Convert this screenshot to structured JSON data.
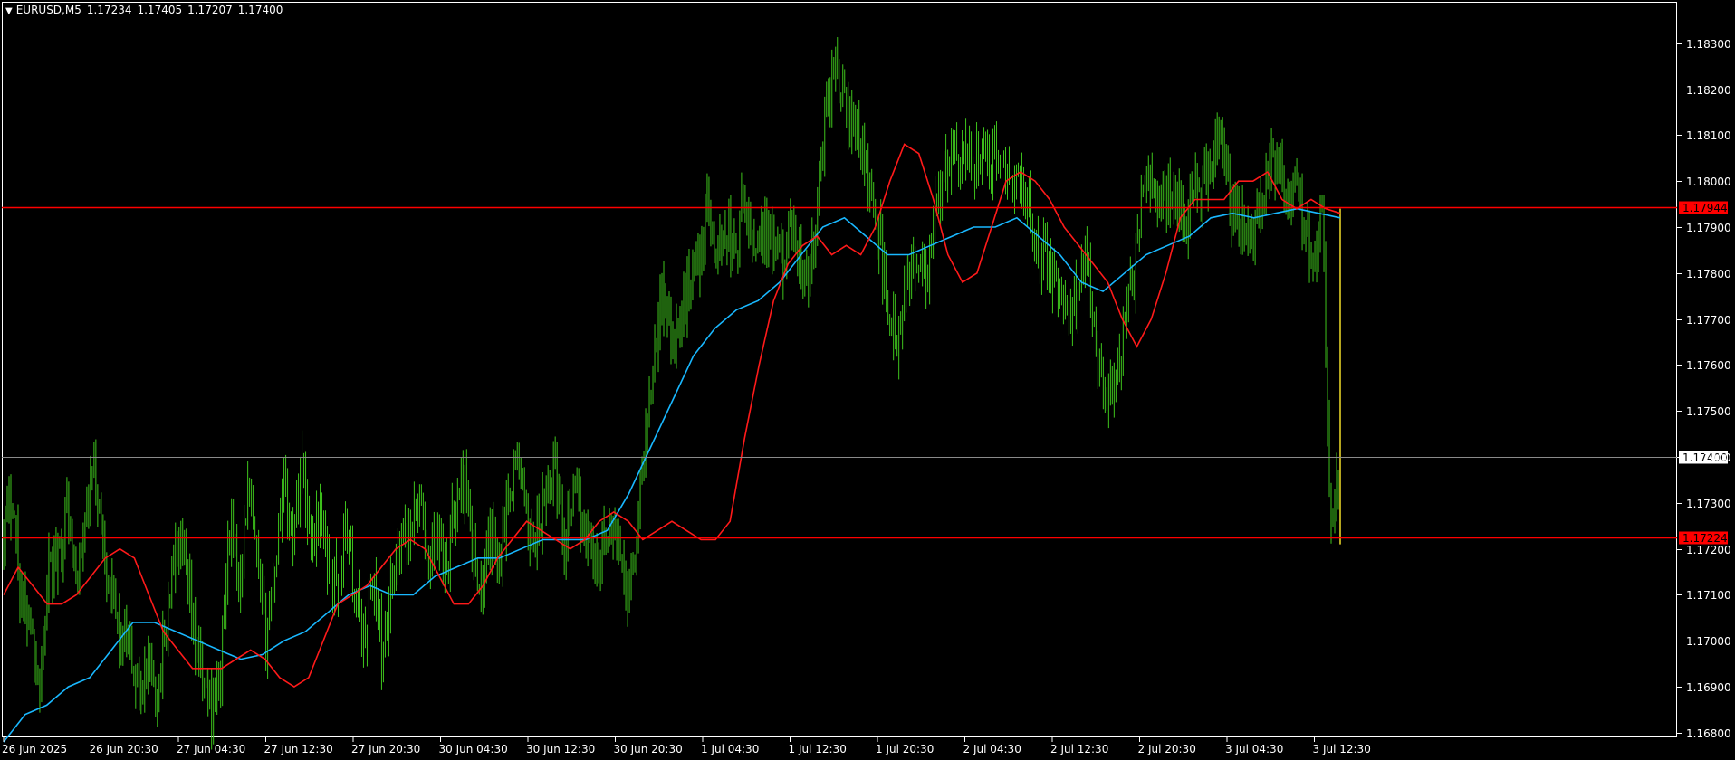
{
  "chart_data": {
    "type": "candlestick",
    "symbol": "EURUSD,M5",
    "ohlc_header": {
      "open": "1.17234",
      "high": "1.17405",
      "low": "1.17207",
      "close": "1.17400"
    },
    "header_arrow": "▼",
    "ylim": [
      1.1679,
      1.1839
    ],
    "y_ticks": [
      "1.18300",
      "1.18200",
      "1.18100",
      "1.18000",
      "1.17900",
      "1.17800",
      "1.17700",
      "1.17600",
      "1.17500",
      "1.17400",
      "1.17300",
      "1.17200",
      "1.17100",
      "1.17000",
      "1.16900",
      "1.16800"
    ],
    "x_tick_labels": [
      "26 Jun 2025",
      "26 Jun 20:30",
      "27 Jun 04:30",
      "27 Jun 12:30",
      "27 Jun 20:30",
      "30 Jun 04:30",
      "30 Jun 12:30",
      "30 Jun 20:30",
      "1 Jul 04:30",
      "1 Jul 12:30",
      "1 Jul 20:30",
      "2 Jul 04:30",
      "2 Jul 12:30",
      "2 Jul 20:30",
      "3 Jul 04:30",
      "3 Jul 12:30"
    ],
    "price_path": [
      1.1725,
      1.1732,
      1.1708,
      1.1704,
      1.169,
      1.1714,
      1.1718,
      1.173,
      1.1712,
      1.1724,
      1.1738,
      1.1722,
      1.171,
      1.17,
      1.1696,
      1.169,
      1.1694,
      1.1688,
      1.1704,
      1.172,
      1.1716,
      1.1702,
      1.1692,
      1.1686,
      1.1692,
      1.1726,
      1.1712,
      1.1732,
      1.1718,
      1.17,
      1.1716,
      1.1736,
      1.1722,
      1.174,
      1.1722,
      1.1728,
      1.1716,
      1.1712,
      1.1726,
      1.1708,
      1.17,
      1.1714,
      1.1694,
      1.1712,
      1.172,
      1.1724,
      1.1732,
      1.1716,
      1.1724,
      1.1718,
      1.1728,
      1.1736,
      1.1718,
      1.1712,
      1.1722,
      1.172,
      1.1734,
      1.174,
      1.1724,
      1.1722,
      1.173,
      1.174,
      1.1722,
      1.1732,
      1.1726,
      1.1722,
      1.1716,
      1.1726,
      1.1722,
      1.171,
      1.1722,
      1.1742,
      1.1764,
      1.1776,
      1.1766,
      1.177,
      1.178,
      1.1784,
      1.1794,
      1.1784,
      1.179,
      1.1784,
      1.1796,
      1.1786,
      1.179,
      1.1786,
      1.1782,
      1.1788,
      1.1784,
      1.1776,
      1.179,
      1.1816,
      1.1826,
      1.1818,
      1.1812,
      1.1808,
      1.1796,
      1.1786,
      1.1772,
      1.1762,
      1.1778,
      1.1784,
      1.1776,
      1.179,
      1.18,
      1.1806,
      1.1808,
      1.1803,
      1.1806,
      1.1802,
      1.1808,
      1.1798,
      1.18,
      1.1798,
      1.179,
      1.1784,
      1.178,
      1.1774,
      1.177,
      1.1778,
      1.1788,
      1.1762,
      1.1754,
      1.1758,
      1.1766,
      1.1778,
      1.1796,
      1.18,
      1.1796,
      1.1798,
      1.1796,
      1.1792,
      1.1798,
      1.18,
      1.1806,
      1.1808,
      1.1792,
      1.179,
      1.1788,
      1.1796,
      1.18,
      1.1806,
      1.1796,
      1.1798,
      1.1791,
      1.1784,
      1.1794,
      1.1722,
      1.174
    ],
    "ma_fast": [
      1.171,
      1.1716,
      1.1712,
      1.1708,
      1.1708,
      1.171,
      1.1714,
      1.1718,
      1.172,
      1.1718,
      1.171,
      1.1702,
      1.1698,
      1.1694,
      1.1694,
      1.1694,
      1.1696,
      1.1698,
      1.1696,
      1.1692,
      1.169,
      1.1692,
      1.17,
      1.1708,
      1.171,
      1.1712,
      1.1716,
      1.172,
      1.1722,
      1.172,
      1.1714,
      1.1708,
      1.1708,
      1.1712,
      1.1718,
      1.1722,
      1.1726,
      1.1724,
      1.1722,
      1.172,
      1.1722,
      1.1726,
      1.1728,
      1.1726,
      1.1722,
      1.1724,
      1.1726,
      1.1724,
      1.1722,
      1.1722,
      1.1726,
      1.1744,
      1.176,
      1.1774,
      1.1782,
      1.1786,
      1.1788,
      1.1784,
      1.1786,
      1.1784,
      1.179,
      1.18,
      1.1808,
      1.1806,
      1.1796,
      1.1784,
      1.1778,
      1.178,
      1.179,
      1.18,
      1.1802,
      1.18,
      1.1796,
      1.179,
      1.1786,
      1.1782,
      1.1778,
      1.177,
      1.1764,
      1.177,
      1.178,
      1.1792,
      1.1796,
      1.1796,
      1.1796,
      1.18,
      1.18,
      1.1802,
      1.1796,
      1.1794,
      1.1796,
      1.1794,
      1.1793
    ],
    "ma_slow": [
      1.1678,
      1.1684,
      1.1686,
      1.169,
      1.1692,
      1.1698,
      1.1704,
      1.1704,
      1.1702,
      1.17,
      1.1698,
      1.1696,
      1.1697,
      1.17,
      1.1702,
      1.1706,
      1.171,
      1.1712,
      1.171,
      1.171,
      1.1714,
      1.1716,
      1.1718,
      1.1718,
      1.172,
      1.1722,
      1.1722,
      1.1722,
      1.1724,
      1.1732,
      1.1742,
      1.1752,
      1.1762,
      1.1768,
      1.1772,
      1.1774,
      1.1778,
      1.1784,
      1.179,
      1.1792,
      1.1788,
      1.1784,
      1.1784,
      1.1786,
      1.1788,
      1.179,
      1.179,
      1.1792,
      1.1788,
      1.1784,
      1.1778,
      1.1776,
      1.178,
      1.1784,
      1.1786,
      1.1788,
      1.1792,
      1.1793,
      1.1792,
      1.1793,
      1.1794,
      1.1793,
      1.1792
    ],
    "horizontal_lines": [
      {
        "price": 1.17944,
        "label": "1.17944",
        "color": "#ff0000",
        "label_bg": "#ff0000",
        "label_color": "#000000"
      },
      {
        "price": 1.174,
        "label": "1.17400",
        "color": "#8a8a8a",
        "label_bg": "#ffffff",
        "label_color": "#000000"
      },
      {
        "price": 1.17224,
        "label": "1.17224",
        "color": "#ff0000",
        "label_bg": "#ff0000",
        "label_color": "#000000"
      }
    ],
    "colors": {
      "background": "#000000",
      "candles": "#3ec41c",
      "ma_fast": "#ff1a1a",
      "ma_slow": "#19b8ff",
      "frame": "#ffffff",
      "text": "#ffffff"
    },
    "grid": false,
    "legend": "none"
  }
}
